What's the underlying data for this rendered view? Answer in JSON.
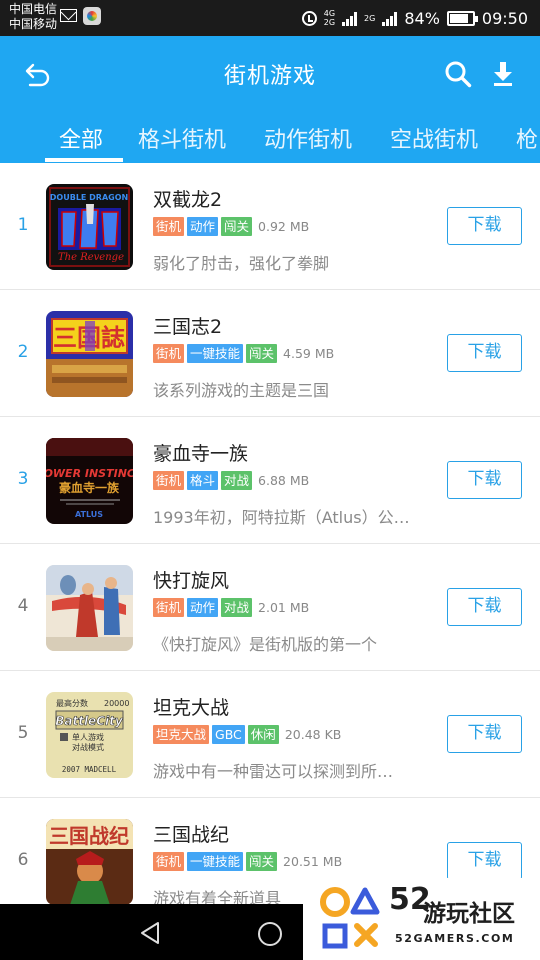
{
  "status_bar": {
    "carrier_1": "中国电信",
    "carrier_2": "中国移动",
    "net_1": "4G",
    "net_2": "2G",
    "net_3": "2G",
    "battery": "84%",
    "time": "09:50"
  },
  "header": {
    "title": "街机游戏",
    "back_icon": "back-arrow-icon",
    "search_icon": "search-icon",
    "download_icon": "download-icon",
    "color": "#1fa7f2"
  },
  "tabs": [
    "全部",
    "格斗街机",
    "动作街机",
    "空战街机",
    "枪"
  ],
  "active_tab": 0,
  "games": [
    {
      "rank": "1",
      "name": "双截龙2",
      "tags": [
        "街机",
        "动作",
        "闯关"
      ],
      "size": "0.92 MB",
      "desc": "弱化了肘击，强化了拳脚",
      "button": "下载"
    },
    {
      "rank": "2",
      "name": "三国志2",
      "tags": [
        "街机",
        "一键技能",
        "闯关"
      ],
      "size": "4.59 MB",
      "desc": "该系列游戏的主题是三国",
      "button": "下载"
    },
    {
      "rank": "3",
      "name": "豪血寺一族",
      "tags": [
        "街机",
        "格斗",
        "对战"
      ],
      "size": "6.88 MB",
      "desc": "1993年初，阿特拉斯（Atlus）公…",
      "button": "下载"
    },
    {
      "rank": "4",
      "name": "快打旋风",
      "tags": [
        "街机",
        "动作",
        "对战"
      ],
      "size": "2.01 MB",
      "desc": "《快打旋风》是街机版的第一个",
      "button": "下载"
    },
    {
      "rank": "5",
      "name": "坦克大战",
      "tags": [
        "坦克大战",
        "GBC",
        "休闲"
      ],
      "size": "20.48 KB",
      "desc": "游戏中有一种雷达可以探测到所…",
      "button": "下载"
    },
    {
      "rank": "6",
      "name": "三国战纪",
      "tags": [
        "街机",
        "一键技能",
        "闯关"
      ],
      "size": "20.51 MB",
      "desc": "游戏有着全新道具",
      "button": "下载"
    }
  ],
  "tag_colors": {
    "orange": "#f58a5d",
    "blue": "#42a5f5",
    "green": "#5cc26a"
  },
  "thumb_texts": {
    "g1_top": "DOUBLE DRAGON",
    "g3_top": "POWER INSTINCT",
    "g3_sub": "ATLUS",
    "g5_score_label": "最高分数",
    "g5_score": "20000",
    "g5_title": "BattleCity",
    "g5_mode_1": "单人游戏",
    "g5_mode_2": "对战模式",
    "g5_footer": "2007 MADCELL"
  },
  "watermark": {
    "number": "52",
    "name": "游玩社区",
    "domain": "52GAMERS.COM"
  }
}
